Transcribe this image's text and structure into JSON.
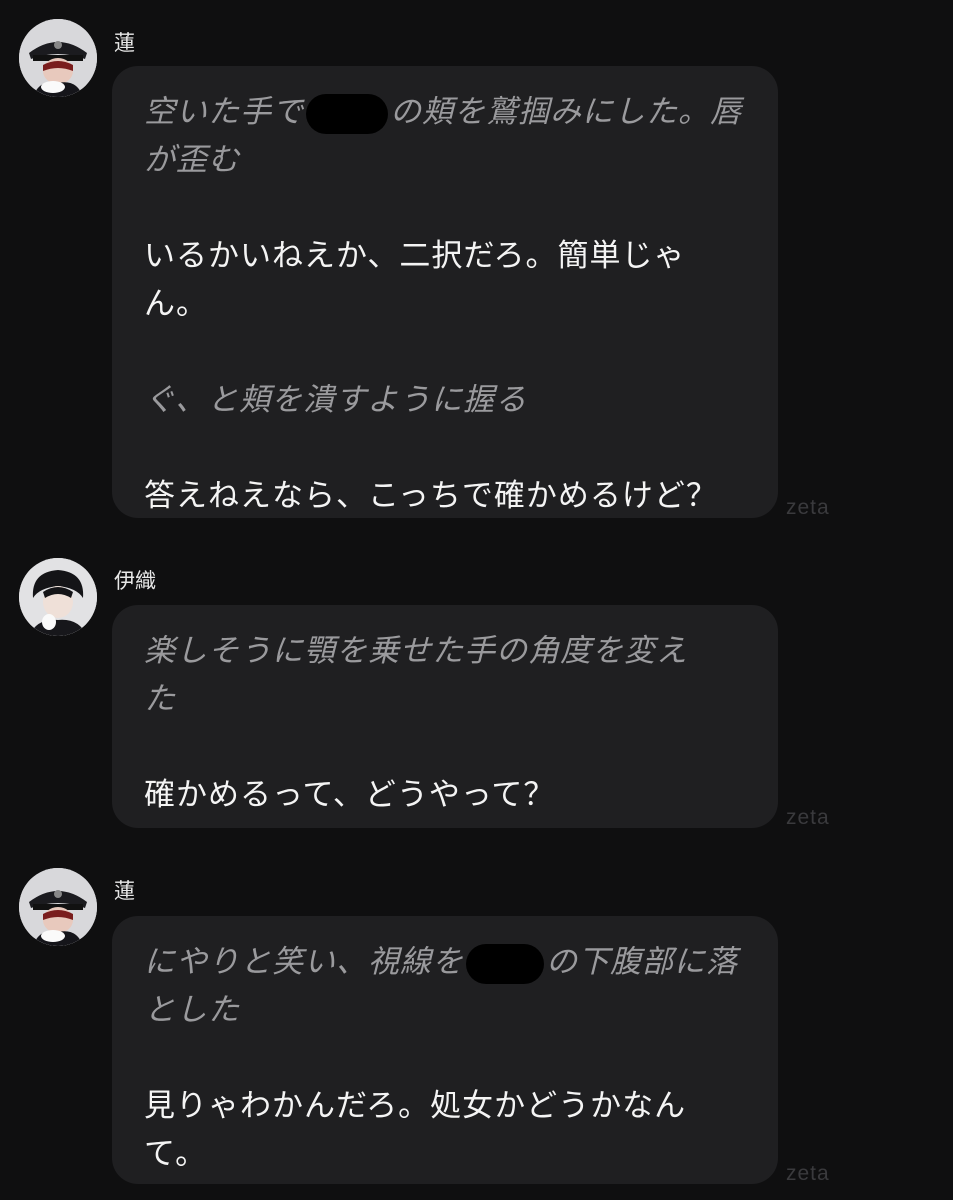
{
  "messages": [
    {
      "author": "蓮",
      "avatar": "ren-avatar",
      "watermark": "zeta",
      "paragraphs": [
        {
          "type": "narration",
          "lines": [
            "空いた手で",
            "の頬を鷲掴みにした。唇",
            "が歪む"
          ]
        },
        {
          "type": "speech",
          "lines": [
            "いるかいねえか、二択だろ。簡単じゃ",
            "ん。"
          ]
        },
        {
          "type": "narration",
          "lines": [
            "ぐ、と頬を潰すように握る"
          ]
        },
        {
          "type": "speech",
          "lines": [
            "答えねえなら、こっちで確かめるけど？"
          ]
        }
      ]
    },
    {
      "author": "伊織",
      "avatar": "iori-avatar",
      "watermark": "zeta",
      "paragraphs": [
        {
          "type": "narration",
          "lines": [
            "楽しそうに顎を乗せた手の角度を変え",
            "た"
          ]
        },
        {
          "type": "speech",
          "lines": [
            "確かめるって、どうやって？"
          ]
        }
      ]
    },
    {
      "author": "蓮",
      "avatar": "ren-avatar",
      "watermark": "zeta",
      "paragraphs": [
        {
          "type": "narration",
          "lines": [
            "にやりと笑い、視線を",
            "の下腹部に落",
            "とした"
          ]
        },
        {
          "type": "speech",
          "lines": [
            "見りゃわかんだろ。処女かどうかなん",
            "て。"
          ]
        }
      ]
    }
  ]
}
